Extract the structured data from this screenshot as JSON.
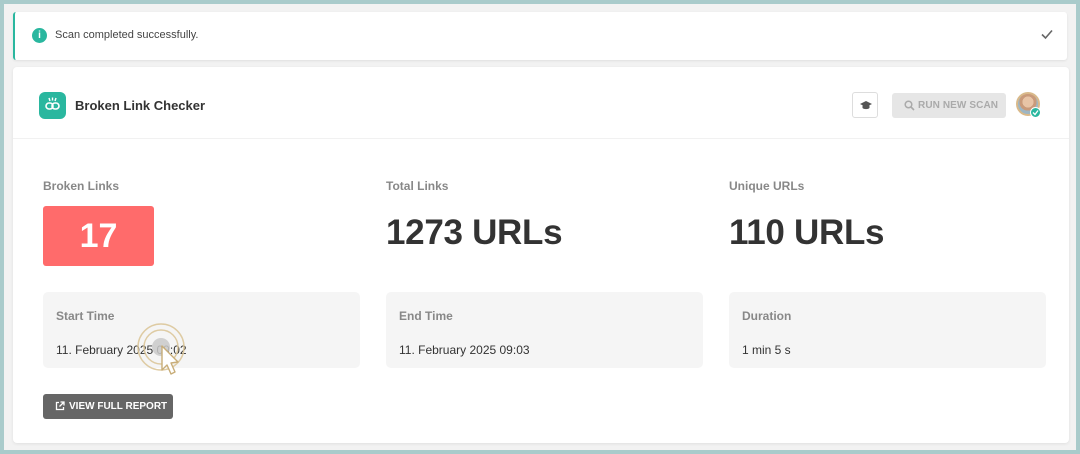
{
  "notice": {
    "message": "Scan completed successfully.",
    "info_icon": "i"
  },
  "header": {
    "title": "Broken Link Checker",
    "run_scan_label": "RUN NEW SCAN"
  },
  "stats": {
    "broken": {
      "label": "Broken Links",
      "value": "17"
    },
    "total": {
      "label": "Total Links",
      "value": "1273 URLs"
    },
    "unique": {
      "label": "Unique URLs",
      "value": "110 URLs"
    }
  },
  "times": {
    "start": {
      "label": "Start Time",
      "value": "11. February 2025 09:02"
    },
    "end": {
      "label": "End Time",
      "value": "11. February 2025 09:03"
    },
    "duration": {
      "label": "Duration",
      "value": "1 min 5 s"
    }
  },
  "report_button_label": "VIEW FULL REPORT",
  "colors": {
    "accent": "#2ab79f",
    "broken": "#ff6b6b",
    "background": "#a9cbcb"
  }
}
